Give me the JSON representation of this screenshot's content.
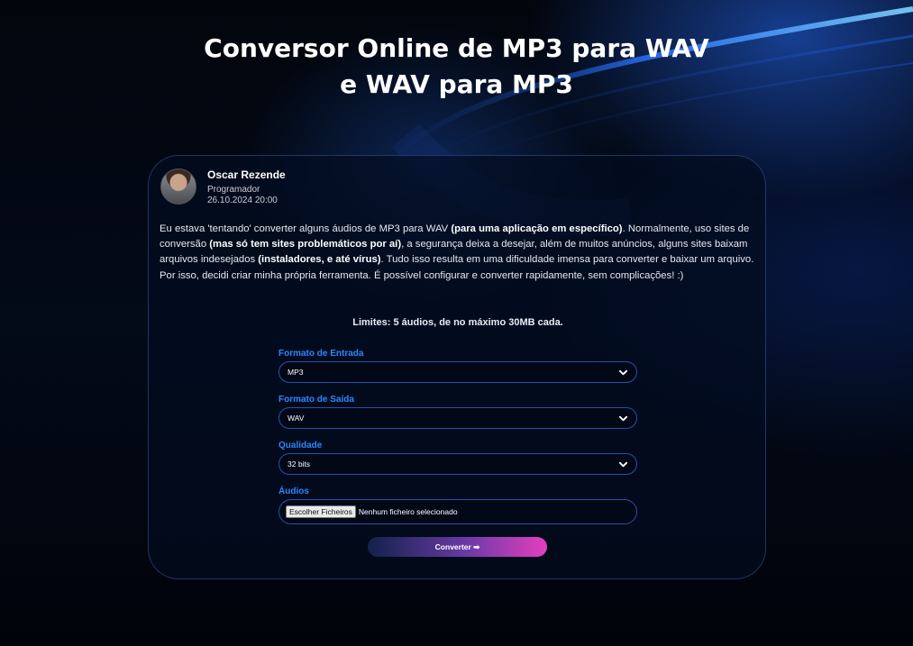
{
  "page": {
    "title_line1": "Conversor Online de MP3 para WAV",
    "title_line2": "e WAV para MP3"
  },
  "author": {
    "name": "Oscar Rezende",
    "role": "Programador",
    "date": "26.10.2024 20:00"
  },
  "intro": {
    "p1": "Eu estava 'tentando' converter alguns áudios de MP3 para WAV ",
    "b1": "(para uma aplicação em específico)",
    "p2": ". Normalmente, uso sites de conversão ",
    "b2": "(mas só tem sites problemáticos por aí)",
    "p3": ", a segurança deixa a desejar, além de muitos anúncios, alguns sites baixam arquivos indesejados ",
    "b3": "(instaladores, e até vírus)",
    "p4": ". Tudo isso resulta em uma dificuldade imensa para converter e baixar um arquivo. Por isso, decidi criar minha própria ferramenta. É possível configurar e converter rapidamente, sem complicações! :)"
  },
  "limits": "Limites: 5 áudios, de no máximo 30MB cada.",
  "form": {
    "input_format": {
      "label": "Formato de Entrada",
      "value": "MP3"
    },
    "output_format": {
      "label": "Formato de Saída",
      "value": "WAV"
    },
    "quality": {
      "label": "Qualidade",
      "value": "32 bits"
    },
    "audios": {
      "label": "Áudios",
      "button": "Escolher Ficheiros",
      "status": "Nenhum ficheiro selecionado"
    },
    "submit": "Converter ➡"
  },
  "icons": {
    "select_chevron": "chevron-down-icon"
  },
  "colors": {
    "accent_label": "#2f86ff",
    "field_border": "#2c4fa8",
    "button_gradient_start": "#12224a",
    "button_gradient_end": "#e43fc0"
  }
}
